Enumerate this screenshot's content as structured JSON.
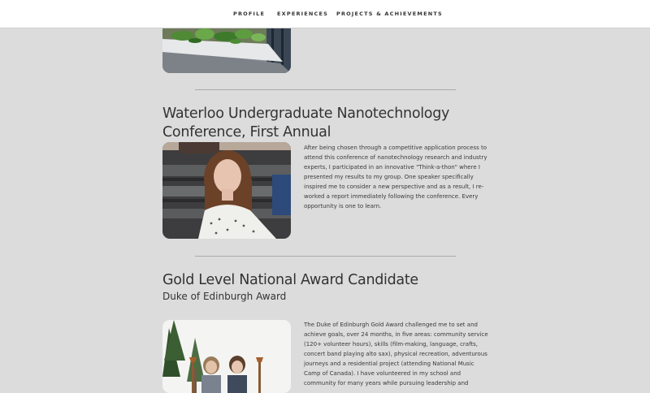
{
  "nav": {
    "items": [
      {
        "label": "PROFILE"
      },
      {
        "label": "EXPERIENCES"
      },
      {
        "label": "PROJECTS & ACHIEVEMENTS"
      }
    ]
  },
  "entries": [
    {
      "title_line1": "Waterloo Undergraduate Nanotechnology",
      "title_line2": "Conference, First Annual",
      "body": "After being chosen through a competitive application process to attend this conference of nanotechnology research and industry experts, I participated in an innovative \"Think-a-thon\" where I presented my results to my group. One speaker specifically inspired me to consider a new perspective and as a result, I re-worked a report immediately following the conference. Every opportunity is one to learn."
    },
    {
      "title": "Gold Level National Award Candidate",
      "subtitle": "Duke of Edinburgh Award",
      "body": "The Duke of Edinburgh Gold Award challenged me to set and achieve goals, over 24 months, in five areas: community service (120+ volunteer hours), skills (film-making, language, crafts, concert band playing alto sax), physical recreation, adventurous journeys and a residential project (attending National Music Camp of Canada). I have volunteered in my school and community for many years while pursuing leadership and"
    }
  ],
  "colors": {
    "page_background": "#dcdcdc",
    "navbar_background": "#ffffff",
    "text": "#333333",
    "divider": "#aaaaaa"
  }
}
